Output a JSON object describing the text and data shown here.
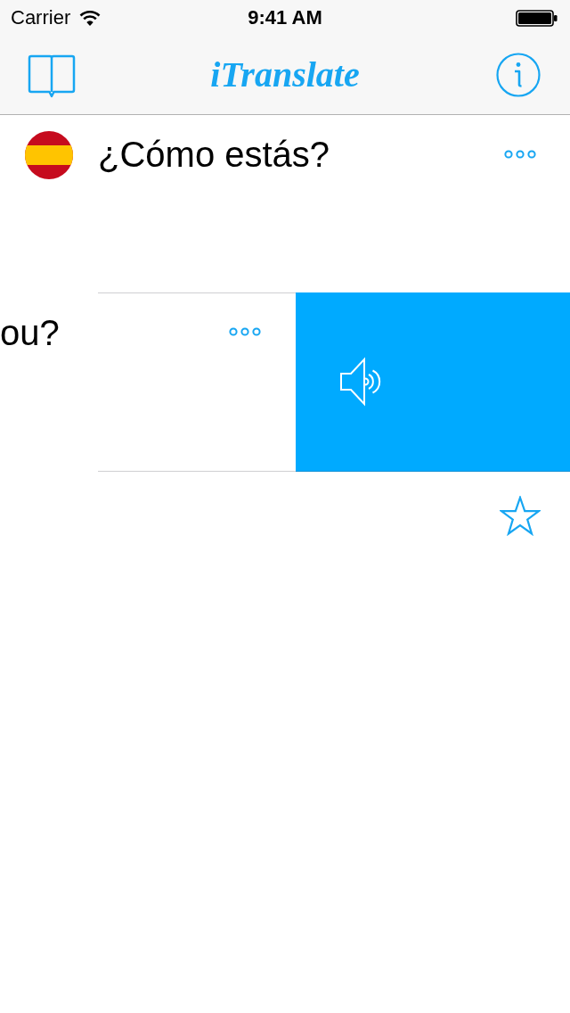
{
  "status_bar": {
    "carrier": "Carrier",
    "time": "9:41 AM"
  },
  "nav_bar": {
    "title": "iTranslate"
  },
  "source": {
    "text": "¿Cómo estás?"
  },
  "translation": {
    "text": "ou?"
  },
  "favorite": {
    "starred": false
  }
}
